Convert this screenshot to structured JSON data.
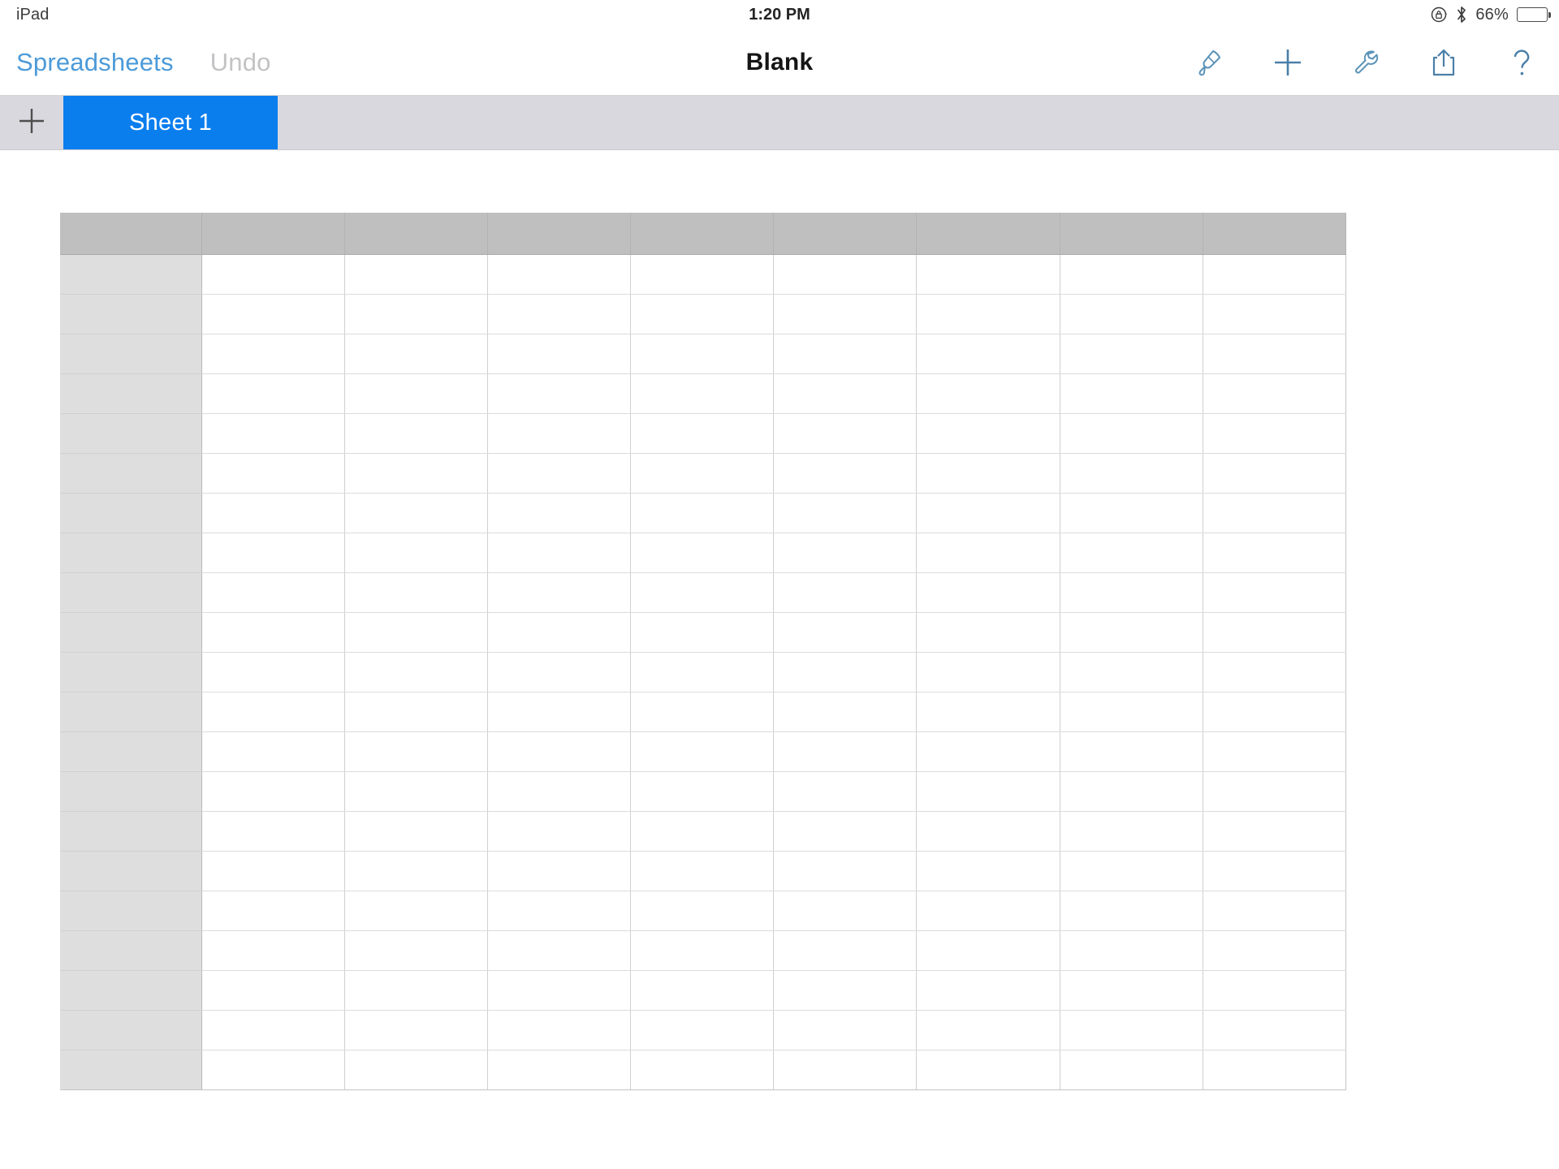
{
  "status_bar": {
    "device_label": "iPad",
    "time": "1:20 PM",
    "battery_percent": "66%",
    "battery_level": 66,
    "icons": [
      "rotation-lock-icon",
      "bluetooth-icon",
      "battery-icon"
    ]
  },
  "toolbar": {
    "back_label": "Spreadsheets",
    "undo_label": "Undo",
    "document_title": "Blank",
    "icons": [
      {
        "name": "format-brush-icon",
        "label": "Format"
      },
      {
        "name": "insert-plus-icon",
        "label": "Insert"
      },
      {
        "name": "tools-wrench-icon",
        "label": "Tools"
      },
      {
        "name": "share-icon",
        "label": "Share"
      },
      {
        "name": "help-question-icon",
        "label": "Help"
      }
    ],
    "accent_color": "#4c9ad8",
    "disabled_color": "#c3c3c5",
    "title_color": "#151515"
  },
  "sheet_bar": {
    "add_sheet_icon": "plus-icon",
    "background_color": "#d8d8de",
    "active_tab_color": "#0b7eee",
    "tabs": [
      {
        "label": "Sheet 1",
        "active": true
      }
    ]
  },
  "table": {
    "column_count": 9,
    "header_row_count": 1,
    "body_row_count": 21,
    "header_fill": "#bfbfbf",
    "row_header_fill": "#dedede",
    "cell_fill": "#ffffff",
    "gridline_color": "#dcdcdc",
    "header_cells": [
      "",
      "",
      "",
      "",
      "",
      "",
      "",
      "",
      ""
    ],
    "rows": [
      [
        "",
        "",
        "",
        "",
        "",
        "",
        "",
        "",
        ""
      ],
      [
        "",
        "",
        "",
        "",
        "",
        "",
        "",
        "",
        ""
      ],
      [
        "",
        "",
        "",
        "",
        "",
        "",
        "",
        "",
        ""
      ],
      [
        "",
        "",
        "",
        "",
        "",
        "",
        "",
        "",
        ""
      ],
      [
        "",
        "",
        "",
        "",
        "",
        "",
        "",
        "",
        ""
      ],
      [
        "",
        "",
        "",
        "",
        "",
        "",
        "",
        "",
        ""
      ],
      [
        "",
        "",
        "",
        "",
        "",
        "",
        "",
        "",
        ""
      ],
      [
        "",
        "",
        "",
        "",
        "",
        "",
        "",
        "",
        ""
      ],
      [
        "",
        "",
        "",
        "",
        "",
        "",
        "",
        "",
        ""
      ],
      [
        "",
        "",
        "",
        "",
        "",
        "",
        "",
        "",
        ""
      ],
      [
        "",
        "",
        "",
        "",
        "",
        "",
        "",
        "",
        ""
      ],
      [
        "",
        "",
        "",
        "",
        "",
        "",
        "",
        "",
        ""
      ],
      [
        "",
        "",
        "",
        "",
        "",
        "",
        "",
        "",
        ""
      ],
      [
        "",
        "",
        "",
        "",
        "",
        "",
        "",
        "",
        ""
      ],
      [
        "",
        "",
        "",
        "",
        "",
        "",
        "",
        "",
        ""
      ],
      [
        "",
        "",
        "",
        "",
        "",
        "",
        "",
        "",
        ""
      ],
      [
        "",
        "",
        "",
        "",
        "",
        "",
        "",
        "",
        ""
      ],
      [
        "",
        "",
        "",
        "",
        "",
        "",
        "",
        "",
        ""
      ],
      [
        "",
        "",
        "",
        "",
        "",
        "",
        "",
        "",
        ""
      ],
      [
        "",
        "",
        "",
        "",
        "",
        "",
        "",
        "",
        ""
      ],
      [
        "",
        "",
        "",
        "",
        "",
        "",
        "",
        "",
        ""
      ]
    ]
  }
}
